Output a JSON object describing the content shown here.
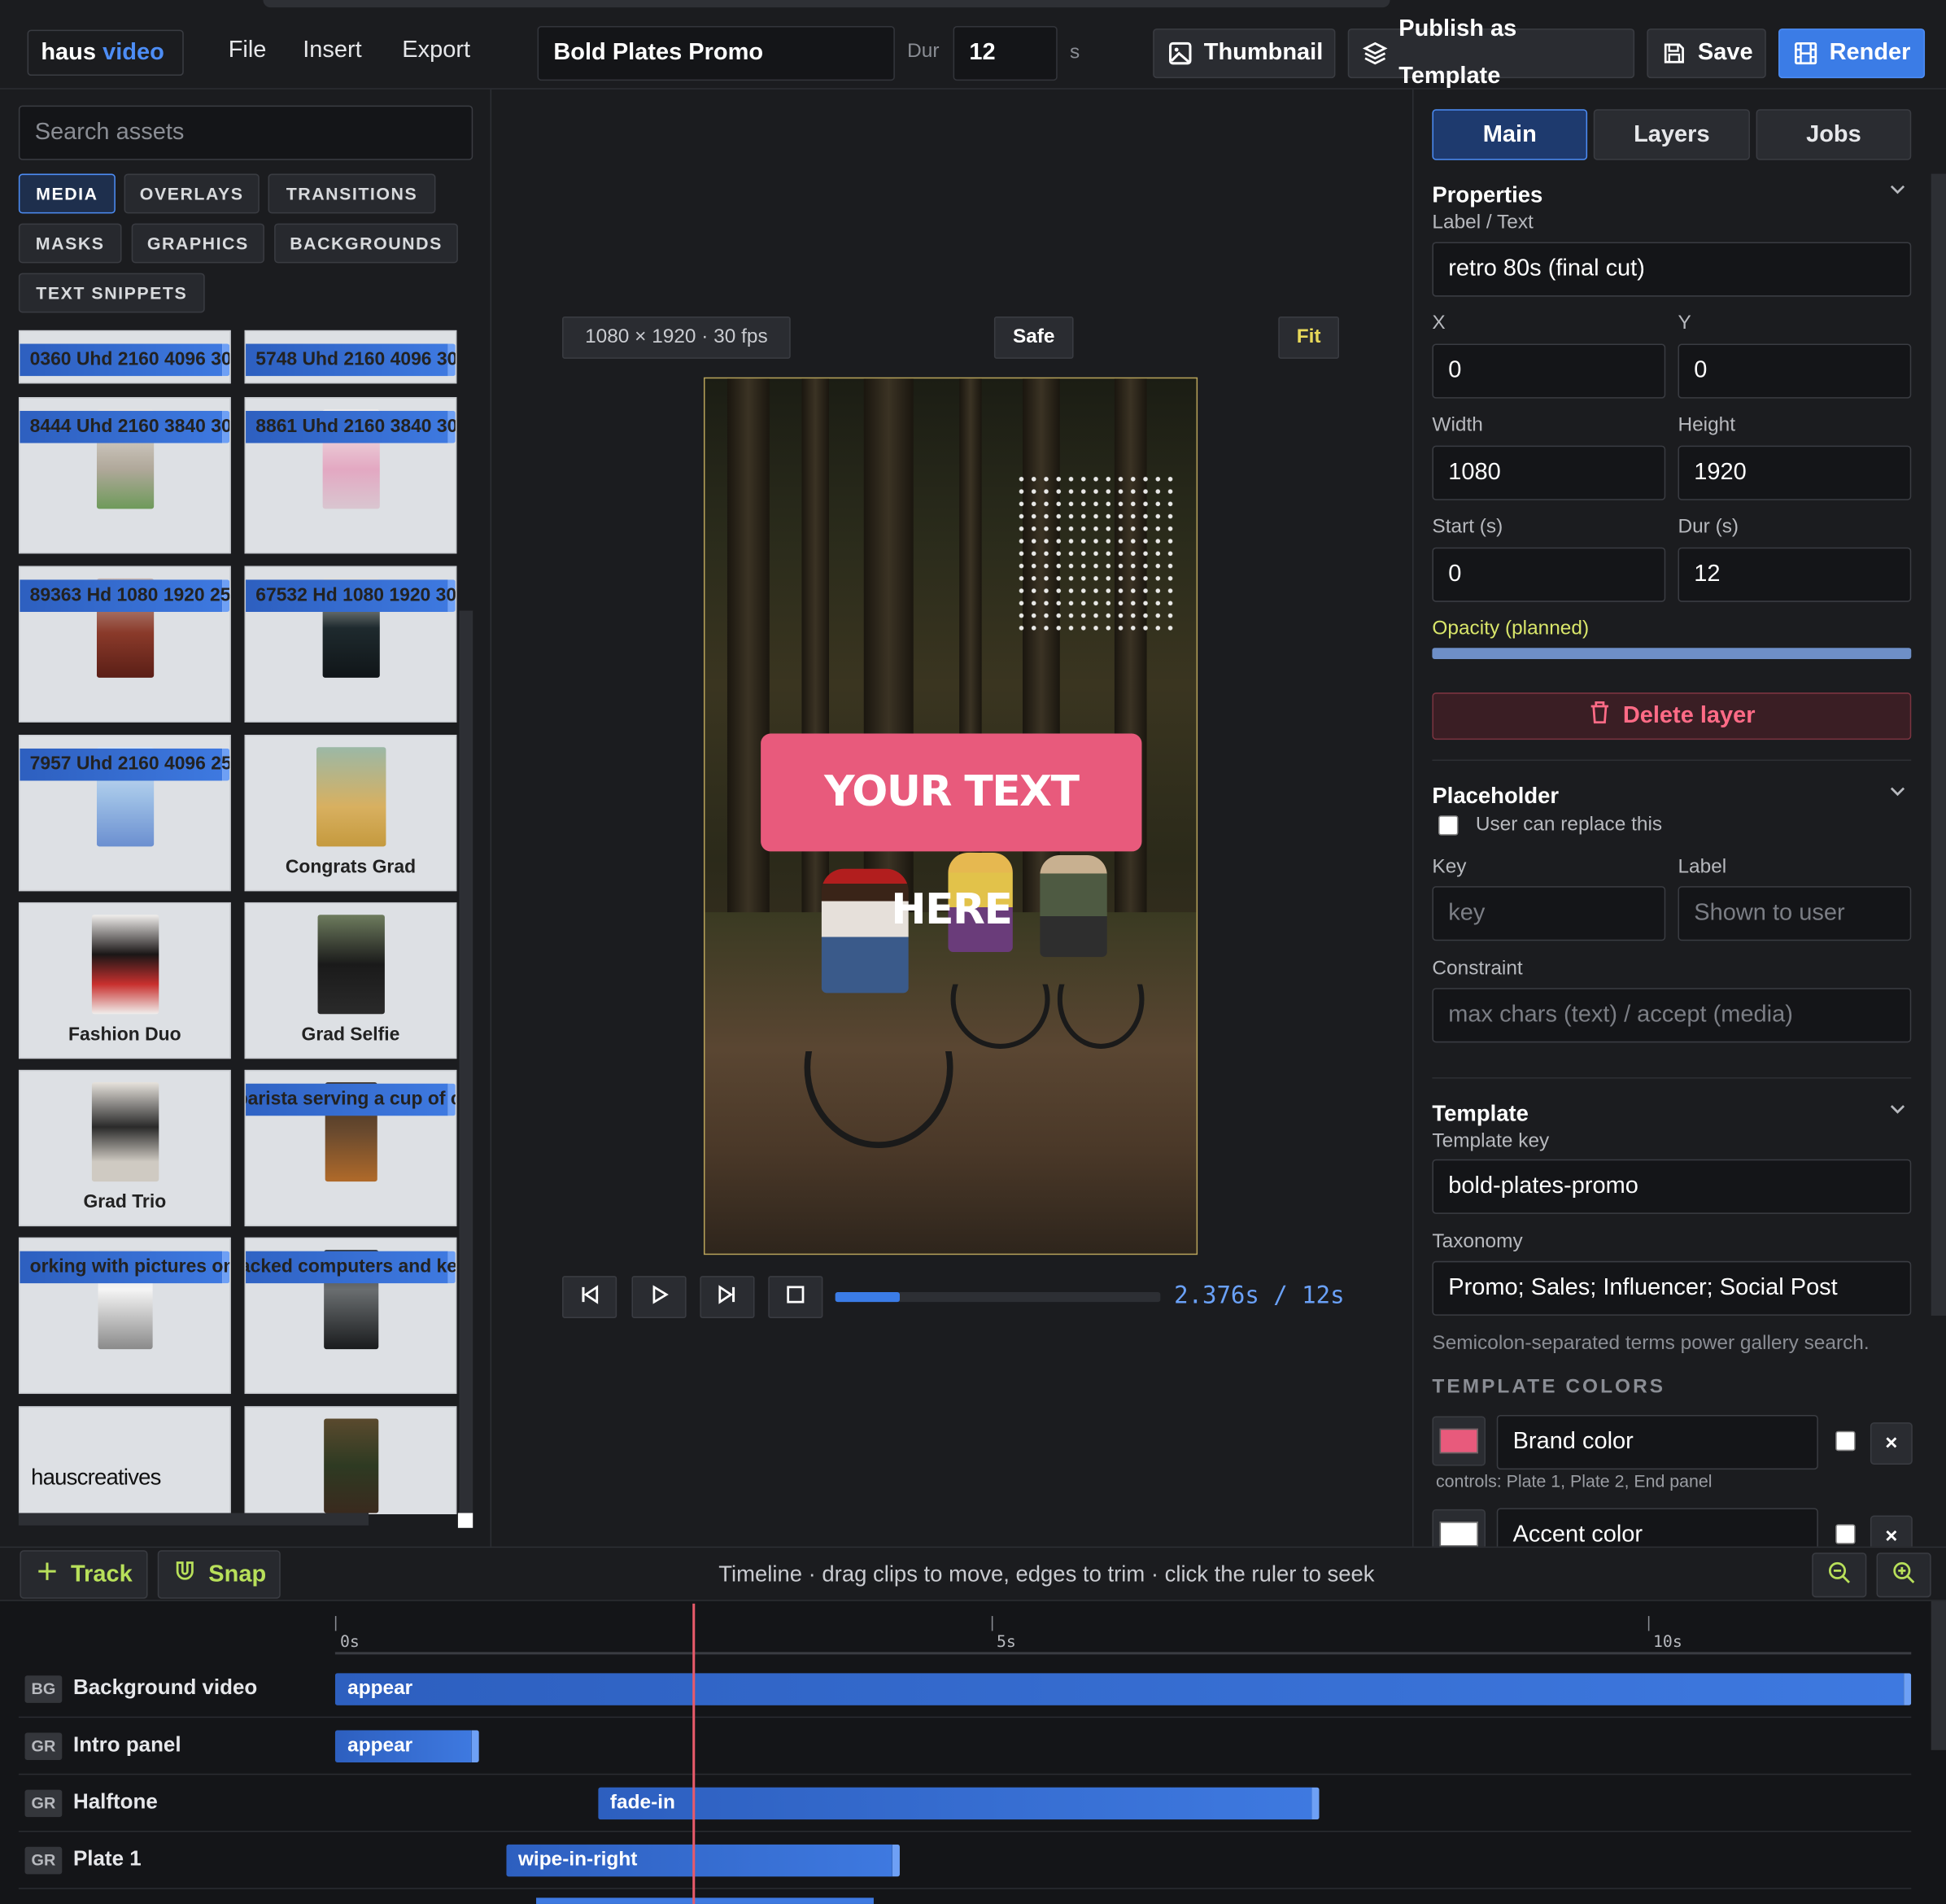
{
  "app": {
    "brand_a": "haus",
    "brand_b": "video"
  },
  "menu": [
    "File",
    "Insert",
    "Export"
  ],
  "project": {
    "title": "Bold Plates Promo",
    "dur_label": "Dur",
    "dur_value": "12",
    "dur_unit": "s"
  },
  "toolbar": {
    "thumbnail": "Thumbnail",
    "publish": "Publish as Template",
    "save": "Save",
    "render": "Render"
  },
  "assets": {
    "search_placeholder": "Search assets",
    "categories": [
      "MEDIA",
      "OVERLAYS",
      "TRANSITIONS",
      "MASKS",
      "GRAPHICS",
      "BACKGROUNDS",
      "TEXT SNIPPETS"
    ],
    "active_category": "MEDIA",
    "items": [
      "0360 Uhd 2160 4096 30",
      "5748 Uhd 2160 4096 30",
      "8444 Uhd 2160 3840 30",
      "8861 Uhd 2160 3840 30",
      "89363 Hd 1080 1920 25",
      "67532 Hd 1080 1920 30",
      "7957 Uhd 2160 4096 25",
      "Congrats Grad",
      "Fashion Duo",
      "Grad Selfie",
      "Grad Trio",
      "a barista serving a cup of co",
      "orking with pictures on",
      "stacked computers and keyb",
      "hauscreatives",
      ""
    ]
  },
  "canvas": {
    "format": "1080 × 1920 · 30 fps",
    "safe": "Safe",
    "fit": "Fit",
    "plate_text": "YOUR TEXT HERE",
    "timecode": "2.376s / 12s",
    "progress": 0.198
  },
  "panel": {
    "tabs": [
      "Main",
      "Layers",
      "Jobs"
    ],
    "active_tab": "Main",
    "properties": {
      "title": "Properties",
      "label_text_label": "Label / Text",
      "label_text_value": "retro 80s (final cut)",
      "x_label": "X",
      "x": "0",
      "y_label": "Y",
      "y": "0",
      "width_label": "Width",
      "width": "1080",
      "height_label": "Height",
      "height": "1920",
      "start_label": "Start (s)",
      "start": "0",
      "dur_label": "Dur (s)",
      "dur": "12",
      "opacity_label": "Opacity (planned)",
      "delete": "Delete layer"
    },
    "placeholder": {
      "title": "Placeholder",
      "replace_label": "User can replace this",
      "key_label": "Key",
      "key_placeholder": "key",
      "label_label": "Label",
      "label_placeholder": "Shown to user",
      "constraint_label": "Constraint",
      "constraint_placeholder": "max chars (text) / accept (media)"
    },
    "template": {
      "title": "Template",
      "key_label": "Template key",
      "key": "bold-plates-promo",
      "taxonomy_label": "Taxonomy",
      "taxonomy": "Promo; Sales; Influencer; Social Post",
      "taxonomy_hint": "Semicolon-separated terms power gallery search.",
      "colors_title": "TEMPLATE COLORS",
      "colors": [
        {
          "name": "Brand color",
          "hex": "#e85a7c",
          "controls": "controls: Plate 1, Plate 2, End panel"
        },
        {
          "name": "Accent color",
          "hex": "#ffffff",
          "controls": ""
        }
      ]
    }
  },
  "timeline": {
    "track_btn": "Track",
    "snap_btn": "Snap",
    "hint": "Timeline · drag clips to move, edges to trim · click the ruler to seek",
    "ticks": [
      "0s",
      "5s",
      "10s"
    ],
    "playhead_s": 2.376,
    "tracks": [
      {
        "tag": "BG",
        "name": "Background video",
        "clip": "appear",
        "start": 0,
        "end": 12
      },
      {
        "tag": "GR",
        "name": "Intro panel",
        "clip": "appear",
        "start": 0,
        "end": 1.1
      },
      {
        "tag": "GR",
        "name": "Halftone",
        "clip": "fade-in",
        "start": 2.0,
        "end": 7.5
      },
      {
        "tag": "GR",
        "name": "Plate 1",
        "clip": "wipe-in-right",
        "start": 1.3,
        "end": 4.3
      }
    ]
  }
}
